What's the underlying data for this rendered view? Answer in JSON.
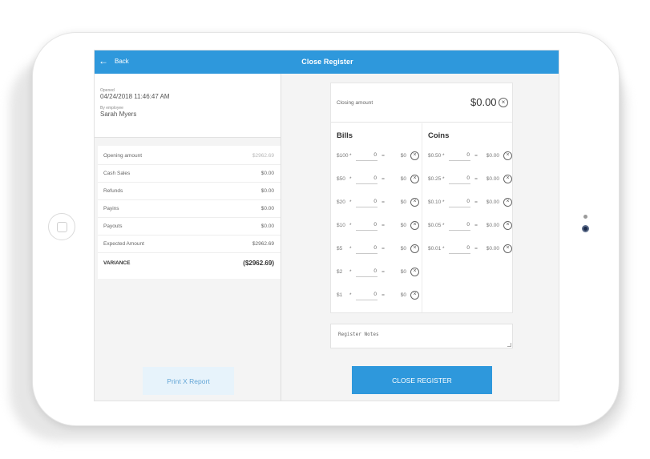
{
  "header": {
    "back_label": "Back",
    "title": "Close Register"
  },
  "info": {
    "opened_label": "Opened",
    "opened_value": "04/24/2018 11:46:47 AM",
    "employee_label": "By employee",
    "employee_value": "Sarah Myers"
  },
  "summary": {
    "rows": [
      {
        "label": "Opening amount",
        "value": "$2962.69"
      },
      {
        "label": "Cash Sales",
        "value": "$0.00"
      },
      {
        "label": "Refunds",
        "value": "$0.00"
      },
      {
        "label": "Payins",
        "value": "$0.00"
      },
      {
        "label": "Payouts",
        "value": "$0.00"
      },
      {
        "label": "Expected Amount",
        "value": "$2962.69"
      },
      {
        "label": "VARIANCE",
        "value": "($2962.69)"
      }
    ]
  },
  "print_button": "Print X Report",
  "closing": {
    "label": "Closing amount",
    "value": "$0.00"
  },
  "bills": {
    "heading": "Bills",
    "rows": [
      {
        "denom": "$100",
        "qty": "0",
        "total": "$0"
      },
      {
        "denom": "$50",
        "qty": "0",
        "total": "$0"
      },
      {
        "denom": "$20",
        "qty": "0",
        "total": "$0"
      },
      {
        "denom": "$10",
        "qty": "0",
        "total": "$0"
      },
      {
        "denom": "$5",
        "qty": "0",
        "total": "$0"
      },
      {
        "denom": "$2",
        "qty": "0",
        "total": "$0"
      },
      {
        "denom": "$1",
        "qty": "0",
        "total": "$0"
      }
    ]
  },
  "coins": {
    "heading": "Coins",
    "rows": [
      {
        "denom": "$0.50",
        "qty": "0",
        "total": "$0.00"
      },
      {
        "denom": "$0.25",
        "qty": "0",
        "total": "$0.00"
      },
      {
        "denom": "$0.10",
        "qty": "0",
        "total": "$0.00"
      },
      {
        "denom": "$0.05",
        "qty": "0",
        "total": "$0.00"
      },
      {
        "denom": "$0.01",
        "qty": "0",
        "total": "$0.00"
      }
    ]
  },
  "symbols": {
    "times": "*",
    "equals": "=",
    "clear": "×",
    "back_arrow": "←"
  },
  "notes": {
    "placeholder": "Register Notes"
  },
  "close_button": "CLOSE REGISTER",
  "colors": {
    "accent": "#2e98dc",
    "print_bg": "#e7f3fb",
    "print_text": "#64a6d6"
  },
  "icons": {
    "back": "arrow-left-icon",
    "clear": "circle-x-icon"
  }
}
